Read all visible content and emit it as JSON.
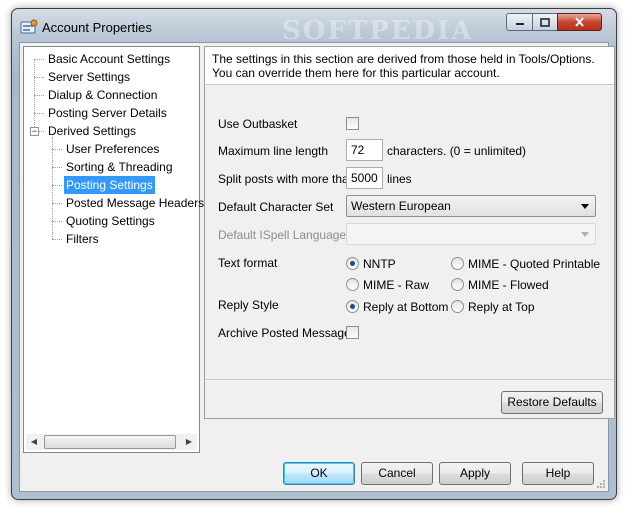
{
  "window": {
    "title": "Account Properties",
    "watermark": "SOFTPEDIA"
  },
  "tree": {
    "items": [
      {
        "label": "Basic Account Settings"
      },
      {
        "label": "Server Settings"
      },
      {
        "label": "Dialup & Connection"
      },
      {
        "label": "Posting Server Details"
      },
      {
        "label": "Derived Settings"
      },
      {
        "label": "User Preferences"
      },
      {
        "label": "Sorting & Threading"
      },
      {
        "label": "Posting Settings"
      },
      {
        "label": "Posted Message Headers"
      },
      {
        "label": "Quoting Settings"
      },
      {
        "label": "Filters"
      }
    ],
    "expander_symbol": "−"
  },
  "panel": {
    "description": "The settings in this section are derived from those held in Tools/Options.  You can override them here for this particular account.",
    "use_outbasket": {
      "label": "Use Outbasket"
    },
    "max_line_length": {
      "label": "Maximum line length",
      "value": "72",
      "suffix": "characters.  (0 = unlimited)"
    },
    "split_posts": {
      "label": "Split posts with more than",
      "value": "5000",
      "suffix": "lines"
    },
    "charset": {
      "label": "Default Character Set",
      "value": "Western European"
    },
    "ispell": {
      "label": "Default ISpell Language",
      "value": ""
    },
    "text_format": {
      "label": "Text format",
      "options": [
        {
          "label": "NNTP"
        },
        {
          "label": "MIME - Quoted Printable"
        },
        {
          "label": "MIME - Raw"
        },
        {
          "label": "MIME - Flowed"
        }
      ]
    },
    "reply_style": {
      "label": "Reply Style",
      "options": [
        {
          "label": "Reply at Bottom"
        },
        {
          "label": "Reply at Top"
        }
      ]
    },
    "archive": {
      "label": "Archive Posted Messages"
    },
    "restore_defaults": "Restore Defaults"
  },
  "buttons": {
    "ok": "OK",
    "cancel": "Cancel",
    "apply": "Apply",
    "help": "Help"
  }
}
